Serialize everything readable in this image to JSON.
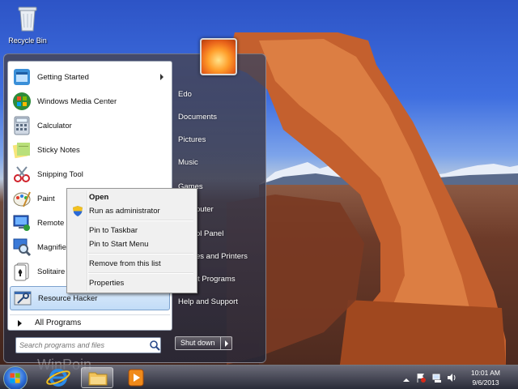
{
  "desktop": {
    "recycle_bin_label": "Recycle Bin",
    "watermark": "WinPoin"
  },
  "start_menu": {
    "programs": [
      {
        "label": "Getting Started",
        "icon": "getting-started-icon",
        "has_submenu": true
      },
      {
        "label": "Windows Media Center",
        "icon": "windows-media-center-icon"
      },
      {
        "label": "Calculator",
        "icon": "calculator-icon"
      },
      {
        "label": "Sticky Notes",
        "icon": "sticky-notes-icon"
      },
      {
        "label": "Snipping Tool",
        "icon": "snipping-tool-icon"
      },
      {
        "label": "Paint",
        "icon": "paint-icon"
      },
      {
        "label": "Remote D",
        "icon": "remote-desktop-icon"
      },
      {
        "label": "Magnifier",
        "icon": "magnifier-icon"
      },
      {
        "label": "Solitaire",
        "icon": "solitaire-icon"
      },
      {
        "label": "Resource Hacker",
        "icon": "resource-hacker-icon",
        "highlighted": true
      }
    ],
    "all_programs": "All Programs",
    "search_placeholder": "Search programs and files",
    "right_links": [
      "Edo",
      "Documents",
      "Pictures",
      "Music",
      "Games",
      "puter",
      "ol Panel",
      "es and Printers",
      "lt Programs",
      "Help and Support"
    ],
    "shutdown_label": "Shut down"
  },
  "context_menu": {
    "items": [
      "Open",
      "Run as administrator",
      "Pin to Taskbar",
      "Pin to Start Menu",
      "Remove from this list",
      "Properties"
    ]
  },
  "taskbar": {
    "time": "10:01 AM",
    "date": "9/6/2013"
  }
}
